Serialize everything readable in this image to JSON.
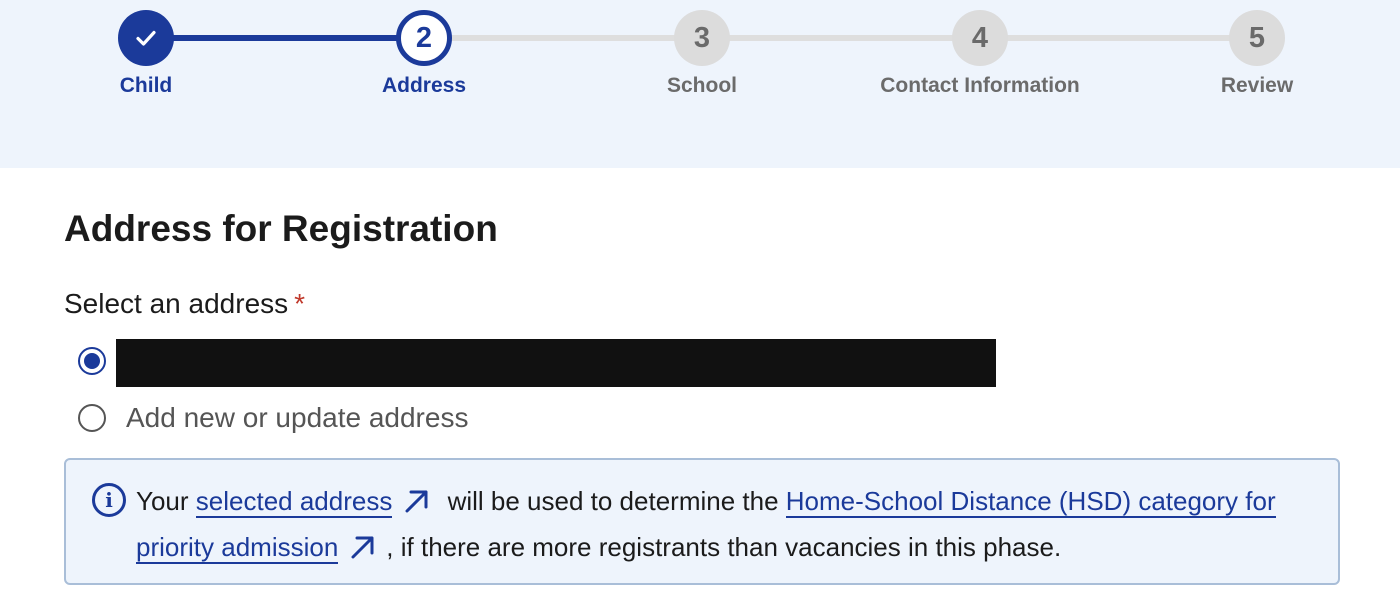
{
  "stepper": {
    "steps": [
      {
        "number": "1",
        "label": "Child",
        "status": "complete"
      },
      {
        "number": "2",
        "label": "Address",
        "status": "current"
      },
      {
        "number": "3",
        "label": "School",
        "status": "upcoming"
      },
      {
        "number": "4",
        "label": "Contact Information",
        "status": "upcoming"
      },
      {
        "number": "5",
        "label": "Review",
        "status": "upcoming"
      }
    ]
  },
  "page": {
    "title": "Address for Registration"
  },
  "address_field": {
    "label": "Select an address",
    "required_mark": "*",
    "options": [
      {
        "label": "",
        "redacted": true,
        "checked": true
      },
      {
        "label": "Add new or update address",
        "checked": false
      }
    ]
  },
  "info": {
    "text_before": "Your",
    "link1": "selected address",
    "text_middle": "will be used to determine the",
    "link2": "Home-School Distance (HSD) category for priority admission",
    "text_after": ", if there are more registrants than vacancies in this phase."
  },
  "icons": {
    "check": "check-icon",
    "info": "info-icon",
    "external": "external-link-icon"
  },
  "colors": {
    "primary": "#1b3a9a",
    "stepper_bg": "#eef4fc",
    "required": "#c0392b",
    "redacted": "#111111"
  }
}
